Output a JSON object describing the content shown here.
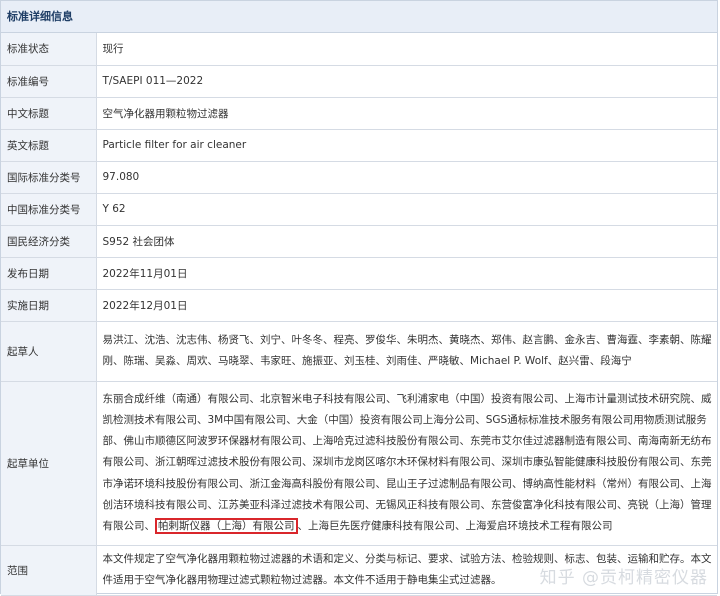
{
  "section_title": "标准详细信息",
  "rows": {
    "status": {
      "label": "标准状态",
      "value": "现行"
    },
    "number": {
      "label": "标准编号",
      "value": "T/SAEPI 011—2022"
    },
    "cn_title": {
      "label": "中文标题",
      "value": "空气净化器用颗粒物过滤器"
    },
    "en_title": {
      "label": "英文标题",
      "value": "Particle filter for air cleaner"
    },
    "ics": {
      "label": "国际标准分类号",
      "value": "97.080"
    },
    "ccs": {
      "label": "中国标准分类号",
      "value": "Y 62"
    },
    "economy": {
      "label": "国民经济分类",
      "value": "S952 社会团体"
    },
    "release": {
      "label": "发布日期",
      "value": "2022年11月01日"
    },
    "implement": {
      "label": "实施日期",
      "value": "2022年12月01日"
    },
    "drafters": {
      "label": "起草人",
      "value": "易洪江、沈浩、沈志伟、杨贤飞、刘宁、叶冬冬、程亮、罗俊华、朱明杰、黄晓杰、郑伟、赵言鹏、金永吉、曹海霆、李素朝、陈耀刚、陈瑞、吴淼、周欢、马晓翠、韦家旺、施振亚、刘玉桂、刘雨佳、严晓敏、Michael P. Wolf、赵兴雷、段海宁"
    },
    "units": {
      "label": "起草单位",
      "value_main": "东丽合成纤维（南通）有限公司、北京智米电子科技有限公司、飞利浦家电（中国）投资有限公司、上海市计量测试技术研究院、威凯检测技术有限公司、3M中国有限公司、大金（中国）投资有限公司上海分公司、SGS通标标准技术服务有限公司用物质测试服务部、佛山市顺德区阿波罗环保器材有限公司、上海哈克过滤科技股份有限公司、东莞市艾尔佳过滤器制造有限公司、南海南新无纺布有限公司、浙江朝晖过滤技术股份有限公司、深圳市龙岗区喀尔木环保材料有限公司、深圳市康弘智能健康科技股份有限公司、东莞市净诺环境科技股份有限公司、浙江金海高科股份有限公司、昆山王子过滤制品有限公司、博纳高性能材料（常州）有限公司、上海创洁环境科技有限公司、江苏美亚科泽过滤技术有限公司、无锡风正科技有限公司、东营俊富净化科技有限公司、亮锐（上海）管理有限公司、",
      "value_highlight": "帕剌斯仪器（上海）有限公司",
      "value_tail": "、上海巨先医疗健康科技有限公司、上海爱启环境技术工程有限公司"
    },
    "scope": {
      "label": "范围",
      "value": "本文件规定了空气净化器用颗粒物过滤器的术语和定义、分类与标记、要求、试验方法、检验规则、标志、包装、运输和贮存。本文件适用于空气净化器用物理过滤式颗粒物过滤器。本文件不适用于静电集尘式过滤器。"
    }
  },
  "watermark": "知乎 @贡柯精密仪器"
}
